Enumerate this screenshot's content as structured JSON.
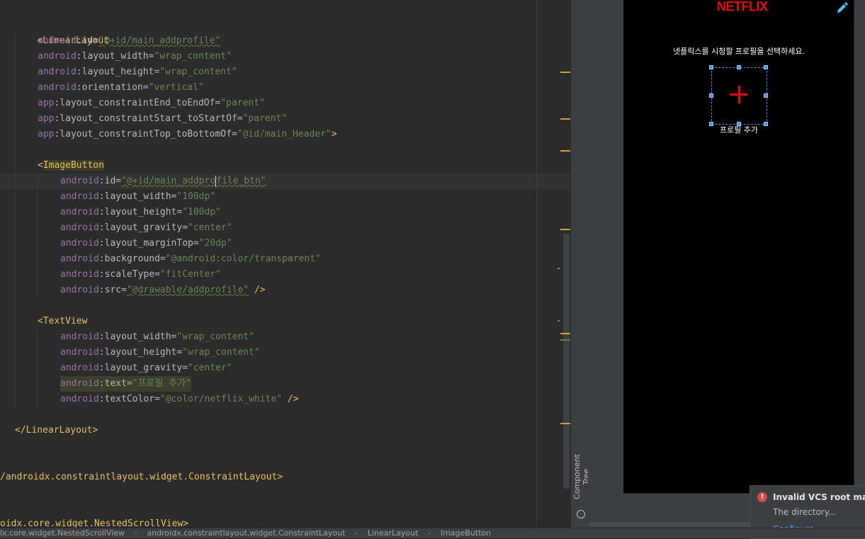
{
  "editor": {
    "lines": {
      "l1_tag": "<LinearLayout",
      "l2": {
        "ns": "android",
        "name": ":id",
        "value": "\"@+id/main_addprofile\""
      },
      "l3": {
        "ns": "android",
        "name": ":layout_width",
        "value": "\"wrap_content\""
      },
      "l4": {
        "ns": "android",
        "name": ":layout_height",
        "value": "\"wrap_content\""
      },
      "l5": {
        "ns": "android",
        "name": ":orientation",
        "value": "\"vertical\""
      },
      "l6": {
        "ns": "app",
        "name": ":layout_constraintEnd_toEndOf",
        "value": "\"parent\""
      },
      "l7": {
        "ns": "app",
        "name": ":layout_constraintStart_toStartOf",
        "value": "\"parent\""
      },
      "l8": {
        "ns": "app",
        "name": ":layout_constraintTop_toBottomOf",
        "value": "\"@id/main_Header\"",
        "close": ">"
      },
      "l9_open": "<",
      "l9_tag": "ImageButton",
      "l10": {
        "ns": "android",
        "name": ":id",
        "value_a": "\"@+id/main_addpro",
        "value_b": "file_btn\""
      },
      "l11": {
        "ns": "android",
        "name": ":layout_width",
        "value": "\"100dp\""
      },
      "l12": {
        "ns": "android",
        "name": ":layout_height",
        "value": "\"100dp\""
      },
      "l13": {
        "ns": "android",
        "name": ":layout_gravity",
        "value": "\"center\""
      },
      "l14": {
        "ns": "android",
        "name": ":layout_marginTop",
        "value": "\"20dp\""
      },
      "l15": {
        "ns": "android",
        "name": ":background",
        "value": "\"@android:color/transparent\""
      },
      "l16": {
        "ns": "android",
        "name": ":scaleType",
        "value": "\"fitCenter\""
      },
      "l17": {
        "ns": "android",
        "name": ":src",
        "value": "\"@drawable/addprofile\"",
        "close": " />"
      },
      "l18_tag": "<TextView",
      "l19": {
        "ns": "android",
        "name": ":layout_width",
        "value": "\"wrap_content\""
      },
      "l20": {
        "ns": "android",
        "name": ":layout_height",
        "value": "\"wrap_content\""
      },
      "l21": {
        "ns": "android",
        "name": ":layout_gravity",
        "value": "\"center\""
      },
      "l22": {
        "ns": "android",
        "name": ":text",
        "value": "\"프로필 추가\""
      },
      "l23": {
        "ns": "android",
        "name": ":textColor",
        "value": "\"@color/netflix_white\"",
        "close": " />"
      },
      "l24_tag": "</LinearLayout>",
      "l25": "/androidx.constraintlayout.widget.ConstraintLayout>",
      "l26": "oidx.core.widget.NestedScrollView>"
    }
  },
  "side_panel": {
    "component_tree_label": "Component Tree"
  },
  "preview": {
    "brand": "NETFLIX",
    "subtitle": "넷플릭스를 시청할 프로필을 선택하세요.",
    "add_profile_label": "프로필 추가",
    "edit_icon": "pencil-icon",
    "add_icon": "plus-icon"
  },
  "notification": {
    "title": "Invalid VCS root mapp",
    "body": "The directory...",
    "link": "Configure..."
  },
  "breadcrumb": {
    "items": [
      "lx.core.widget.NestedScrollView",
      "androidx.constraintlayout.widget.ConstraintLayout",
      "LinearLayout",
      "ImageButton"
    ],
    "separator": "›"
  },
  "colors": {
    "netflix_red": "#e50914",
    "selection_blue": "#4a90e2",
    "editor_bg": "#2b2b2b"
  }
}
